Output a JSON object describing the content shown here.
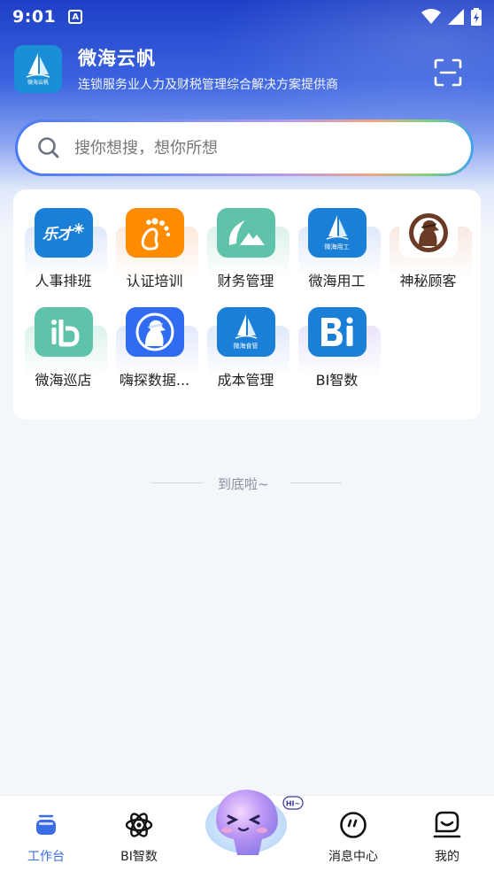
{
  "status_bar": {
    "time": "9:01",
    "badge": "A"
  },
  "header": {
    "title": "微海云帆",
    "subtitle": "连锁服务业人力及财税管理综合解决方案提供商",
    "logo_caption": "微海云帆"
  },
  "search": {
    "placeholder": "搜你想搜，想你所想"
  },
  "apps": [
    {
      "label": "人事排班",
      "icon": "leca-icon",
      "icon_text": "乐才",
      "color": "#1a7fd6",
      "tint": "#e3ecfb"
    },
    {
      "label": "认证培训",
      "icon": "footprint-icon",
      "color": "#ff8c00",
      "tint": "#fdeee2"
    },
    {
      "label": "财务管理",
      "icon": "mountain-icon",
      "color": "#5ec3a9",
      "tint": "#e0f3ee"
    },
    {
      "label": "微海用工",
      "icon": "sail-icon",
      "icon_text": "微海用工",
      "color": "#1a7fd6",
      "tint": "#e3ecfb"
    },
    {
      "label": "神秘顾客",
      "icon": "mystery-customer-icon",
      "color": "#ffffff",
      "tint": "#f8ece6"
    },
    {
      "label": "微海巡店",
      "icon": "ib-icon",
      "color": "#5ec3a9",
      "tint": "#e0f3ee"
    },
    {
      "label": "嗨探数据...",
      "icon": "detective-icon",
      "color": "#2f6cf0",
      "tint": "#e6ecfc"
    },
    {
      "label": "成本管理",
      "icon": "sail-icon",
      "icon_text": "微海食管",
      "color": "#1a7fd6",
      "tint": "#e3ecfb"
    },
    {
      "label": "BI智数",
      "icon": "bi-icon",
      "color": "#1a7fd6",
      "tint": "#ece6fa"
    }
  ],
  "end_text": "到底啦~",
  "bottom_nav": [
    {
      "label": "工作台",
      "icon": "workbench-icon",
      "active": true
    },
    {
      "label": "BI智数",
      "icon": "atom-icon",
      "active": false
    },
    {
      "label": "消息中心",
      "icon": "message-icon",
      "active": false
    },
    {
      "label": "我的",
      "icon": "profile-icon",
      "active": false
    }
  ],
  "mascot": {
    "bubble": "HI~"
  },
  "colors": {
    "accent": "#3a6de6",
    "header_bg": "#2a4fd4"
  }
}
